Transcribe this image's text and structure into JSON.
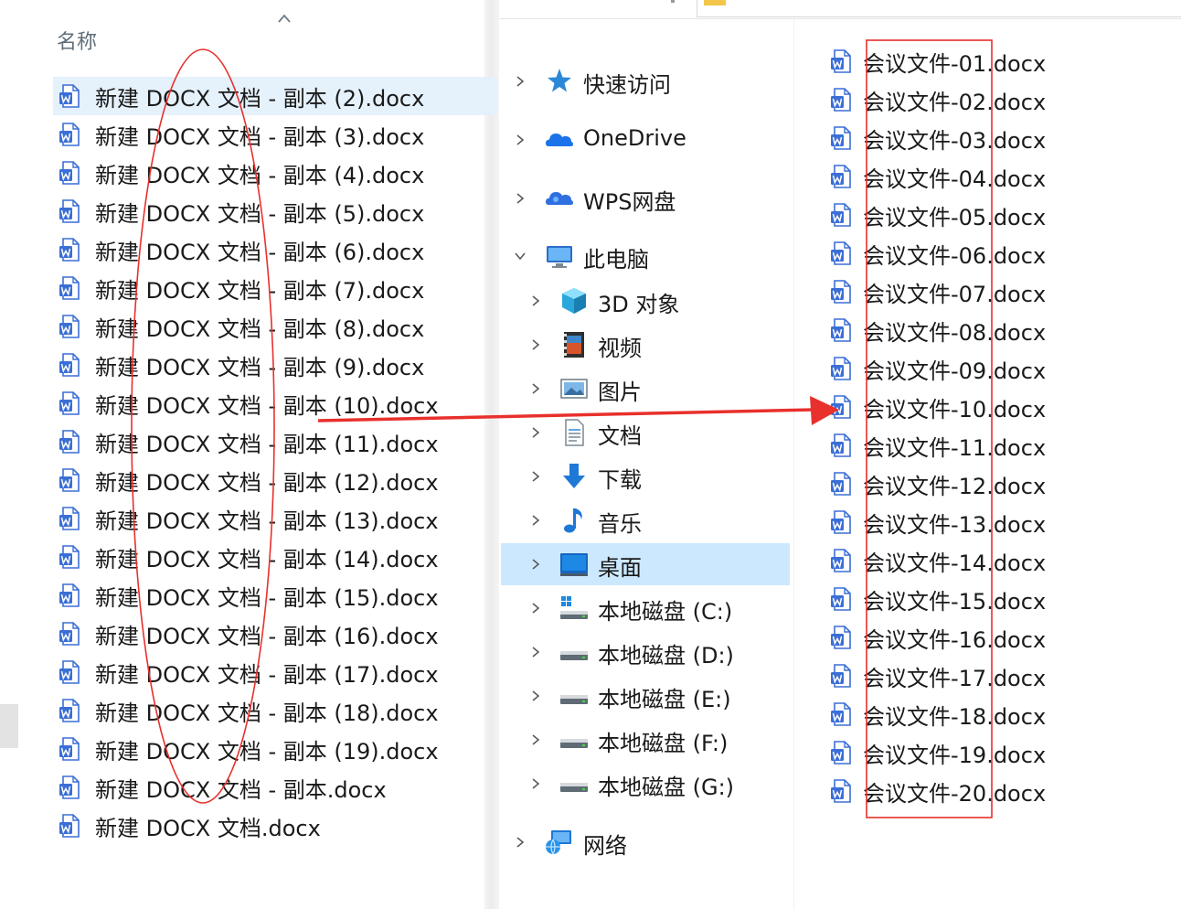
{
  "left_pane": {
    "column_header": "名称",
    "files": [
      {
        "name": "新建 DOCX 文档 - 副本 (2).docx",
        "selected": true
      },
      {
        "name": "新建 DOCX 文档 - 副本 (3).docx",
        "selected": false
      },
      {
        "name": "新建 DOCX 文档 - 副本 (4).docx",
        "selected": false
      },
      {
        "name": "新建 DOCX 文档 - 副本 (5).docx",
        "selected": false
      },
      {
        "name": "新建 DOCX 文档 - 副本 (6).docx",
        "selected": false
      },
      {
        "name": "新建 DOCX 文档 - 副本 (7).docx",
        "selected": false
      },
      {
        "name": "新建 DOCX 文档 - 副本 (8).docx",
        "selected": false
      },
      {
        "name": "新建 DOCX 文档 - 副本 (9).docx",
        "selected": false
      },
      {
        "name": "新建 DOCX 文档 - 副本 (10).docx",
        "selected": false
      },
      {
        "name": "新建 DOCX 文档 - 副本 (11).docx",
        "selected": false
      },
      {
        "name": "新建 DOCX 文档 - 副本 (12).docx",
        "selected": false
      },
      {
        "name": "新建 DOCX 文档 - 副本 (13).docx",
        "selected": false
      },
      {
        "name": "新建 DOCX 文档 - 副本 (14).docx",
        "selected": false
      },
      {
        "name": "新建 DOCX 文档 - 副本 (15).docx",
        "selected": false
      },
      {
        "name": "新建 DOCX 文档 - 副本 (16).docx",
        "selected": false
      },
      {
        "name": "新建 DOCX 文档 - 副本 (17).docx",
        "selected": false
      },
      {
        "name": "新建 DOCX 文档 - 副本 (18).docx",
        "selected": false
      },
      {
        "name": "新建 DOCX 文档 - 副本 (19).docx",
        "selected": false
      },
      {
        "name": "新建 DOCX 文档 - 副本.docx",
        "selected": false
      },
      {
        "name": "新建 DOCX 文档.docx",
        "selected": false
      }
    ]
  },
  "nav_pane": {
    "items": [
      {
        "label": "快速访问",
        "icon": "star-pin-icon",
        "expanded": false,
        "level": 0
      },
      {
        "label": "OneDrive",
        "icon": "onedrive-cloud-icon",
        "expanded": false,
        "level": 0
      },
      {
        "label": "WPS网盘",
        "icon": "wps-cloud-icon",
        "expanded": false,
        "level": 0
      },
      {
        "label": "此电脑",
        "icon": "this-pc-icon",
        "expanded": true,
        "level": 0
      },
      {
        "label": "3D 对象",
        "icon": "3d-objects-icon",
        "expanded": false,
        "level": 1
      },
      {
        "label": "视频",
        "icon": "videos-icon",
        "expanded": false,
        "level": 1
      },
      {
        "label": "图片",
        "icon": "pictures-icon",
        "expanded": false,
        "level": 1
      },
      {
        "label": "文档",
        "icon": "documents-icon",
        "expanded": false,
        "level": 1
      },
      {
        "label": "下载",
        "icon": "downloads-icon",
        "expanded": false,
        "level": 1
      },
      {
        "label": "音乐",
        "icon": "music-icon",
        "expanded": false,
        "level": 1
      },
      {
        "label": "桌面",
        "icon": "desktop-icon",
        "expanded": false,
        "level": 1,
        "selected": true
      },
      {
        "label": "本地磁盘 (C:)",
        "icon": "system-drive-icon",
        "expanded": false,
        "level": 1
      },
      {
        "label": "本地磁盘 (D:)",
        "icon": "drive-icon",
        "expanded": false,
        "level": 1
      },
      {
        "label": "本地磁盘 (E:)",
        "icon": "drive-icon",
        "expanded": false,
        "level": 1
      },
      {
        "label": "本地磁盘 (F:)",
        "icon": "drive-icon",
        "expanded": false,
        "level": 1
      },
      {
        "label": "本地磁盘 (G:)",
        "icon": "drive-icon",
        "expanded": false,
        "level": 1
      },
      {
        "label": "网络",
        "icon": "network-icon",
        "expanded": false,
        "level": 0
      }
    ]
  },
  "right_pane": {
    "files": [
      "会议文件-01.docx",
      "会议文件-02.docx",
      "会议文件-03.docx",
      "会议文件-04.docx",
      "会议文件-05.docx",
      "会议文件-06.docx",
      "会议文件-07.docx",
      "会议文件-08.docx",
      "会议文件-09.docx",
      "会议文件-10.docx",
      "会议文件-11.docx",
      "会议文件-12.docx",
      "会议文件-13.docx",
      "会议文件-14.docx",
      "会议文件-15.docx",
      "会议文件-16.docx",
      "会议文件-17.docx",
      "会议文件-18.docx",
      "会议文件-19.docx",
      "会议文件-20.docx"
    ]
  },
  "annotations": {
    "color": "#e8302c",
    "shapes": [
      "ellipse-around-left-names",
      "arrow-left-to-right",
      "rectangle-around-right-names"
    ]
  },
  "colors": {
    "selection": "#e5f1fb",
    "nav_selected": "#cce8ff",
    "doc_icon_blue": "#3b6fd6",
    "header_text": "#5f6e7a"
  }
}
